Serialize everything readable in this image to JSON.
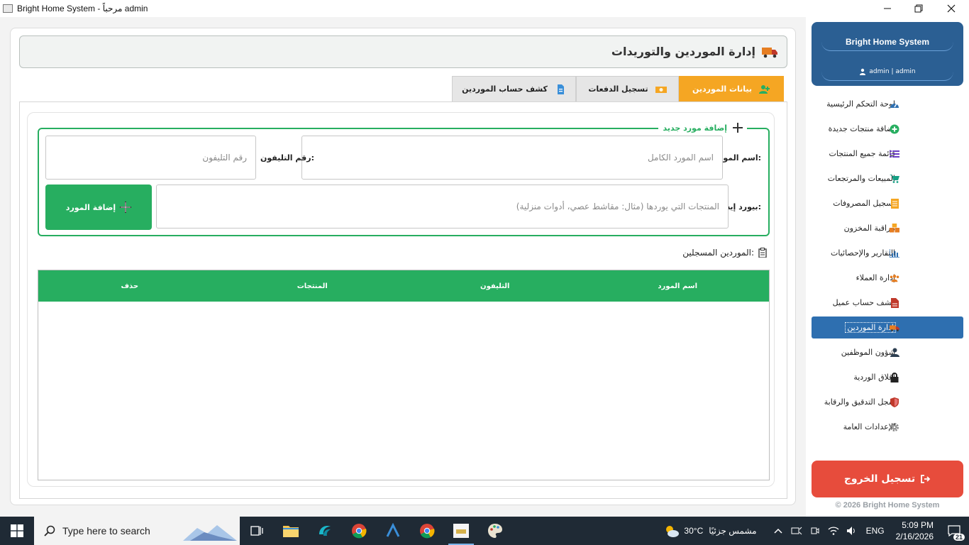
{
  "window": {
    "title": "Bright Home System - مرحباً admin",
    "controls": [
      "minimize",
      "maximize",
      "close"
    ]
  },
  "header": {
    "title": "إدارة الموردين والتوريدات",
    "icon": "truck-icon"
  },
  "tabs": [
    {
      "label": "بيانات الموردين",
      "icon": "user-plus-icon",
      "active": true
    },
    {
      "label": "تسجيل الدفعات",
      "icon": "money-icon",
      "active": false
    },
    {
      "label": "كشف حساب الموردين",
      "icon": "file-icon",
      "active": false
    }
  ],
  "form": {
    "legend": "إضافة مورد جديد",
    "name_label": "اسم المورد:",
    "name_placeholder": "اسم المورد الكامل",
    "phone_label": "رقم التليفون:",
    "phone_placeholder": "رقم التليفون",
    "supplies_label": "بيورد إيه:",
    "supplies_placeholder": "المنتجات التي يوردها (مثال: مقاشط عصي، أدوات منزلية)",
    "add_button": "إضافة المورد"
  },
  "registered": {
    "label": "الموردين المسجلين:",
    "columns": [
      "اسم المورد",
      "التليفون",
      "المنتجات",
      "حذف"
    ],
    "rows": []
  },
  "sidebar": {
    "brand": "Bright Home System",
    "user": "admin | admin",
    "items": [
      {
        "label": "لوحة التحكم الرئيسية",
        "icon": "dashboard-icon",
        "color": "#2e6fb0"
      },
      {
        "label": "إضافة منتجات جديدة",
        "icon": "plus-circle-icon",
        "color": "#27ae60"
      },
      {
        "label": "قائمة جميع المنتجات",
        "icon": "list-icon",
        "color": "#6c3fc5"
      },
      {
        "label": "المبيعات والمرتجعات",
        "icon": "cart-icon",
        "color": "#16a085"
      },
      {
        "label": "تسجيل المصروفات",
        "icon": "receipt-icon",
        "color": "#f5a623"
      },
      {
        "label": "مراقبة المخزون",
        "icon": "boxes-icon",
        "color": "#e67e22"
      },
      {
        "label": "التقارير والإحصائيات",
        "icon": "chart-icon",
        "color": "#2e6fb0"
      },
      {
        "label": "إدارة العملاء",
        "icon": "users-icon",
        "color": "#e67e22"
      },
      {
        "label": "كشف حساب عميل",
        "icon": "file-invoice-icon",
        "color": "#c0392b"
      },
      {
        "label": "إدارة الموردين",
        "icon": "truck-icon",
        "color": "#e67e22",
        "active": true
      },
      {
        "label": "شؤون الموظفين",
        "icon": "user-tie-icon",
        "color": "#2c3e50"
      },
      {
        "label": "إغلاق الوردية",
        "icon": "lock-icon",
        "color": "#222222"
      },
      {
        "label": "سجل التدقيق والرقابة",
        "icon": "shield-icon",
        "color": "#c0392b"
      },
      {
        "label": "الإعدادات العامة",
        "icon": "gear-icon",
        "color": "#8a8a8a"
      }
    ],
    "logout": "تسجيل الخروج",
    "copyright": "© 2026 Bright Home System"
  },
  "taskbar": {
    "search_placeholder": "Type here to search",
    "weather_temp": "30°C",
    "weather_text": "مشمس جزئيًا",
    "language": "ENG",
    "time": "5:09 PM",
    "date": "2/16/2026",
    "notifications": "21"
  },
  "colors": {
    "accent_green": "#27ae60",
    "accent_orange": "#f5a623",
    "brand_blue": "#2b5f93",
    "logout_red": "#e74c3c"
  }
}
